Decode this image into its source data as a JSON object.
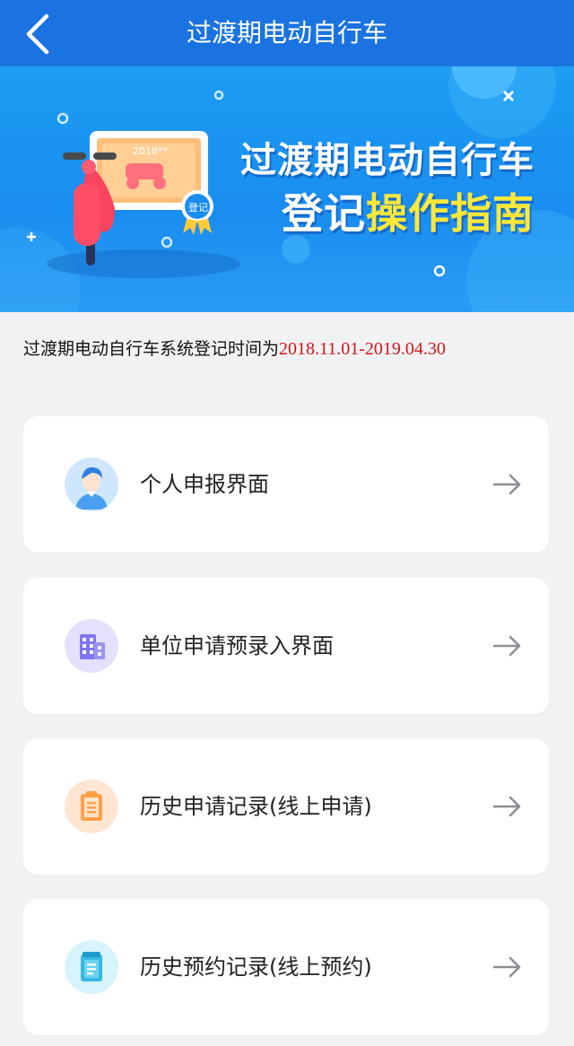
{
  "header": {
    "title": "过渡期电动自行车",
    "back_icon": "chevron-left-icon"
  },
  "banner": {
    "heading": "过渡期电动自行车",
    "subheading_white": "登记",
    "subheading_yellow": "操作指南",
    "card_year": "2018**",
    "badge_text": "登记",
    "colors": {
      "background": "#1a8df0",
      "highlight": "#ffe83a"
    }
  },
  "notice": {
    "text": "过渡期电动自行车系统登记时间为",
    "dates": "2018.11.01-2019.04.30"
  },
  "menu": {
    "items": [
      {
        "label": "个人申报界面",
        "icon": "person-avatar-icon",
        "arrow": "arrow-right-icon"
      },
      {
        "label": "单位申请预录入界面",
        "icon": "building-icon",
        "arrow": "arrow-right-icon"
      },
      {
        "label": "历史申请记录(线上申请)",
        "icon": "clipboard-icon",
        "arrow": "arrow-right-icon"
      },
      {
        "label": "历史预约记录(线上预约)",
        "icon": "notepad-icon",
        "arrow": "arrow-right-icon"
      }
    ]
  }
}
